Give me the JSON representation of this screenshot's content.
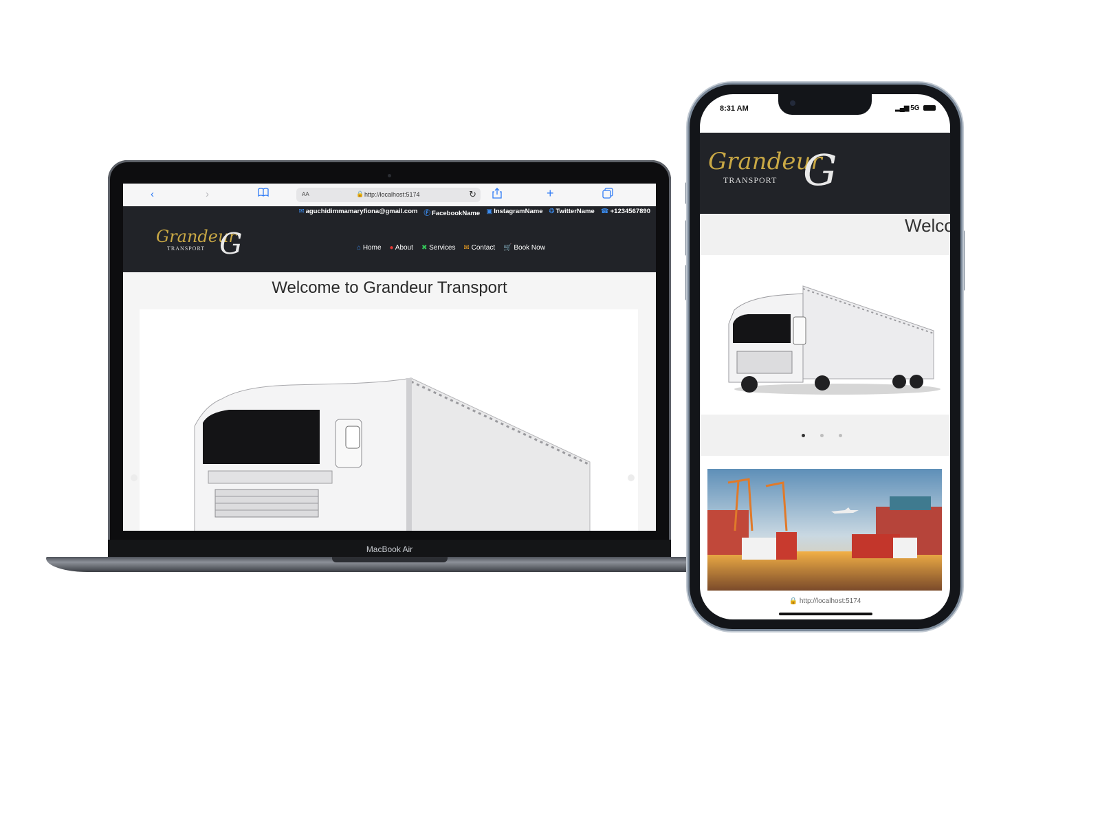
{
  "laptop": {
    "model_label": "MacBook Air",
    "browser": {
      "aa_label": "AA",
      "url": "http://localhost:5174",
      "back_icon": "chevron-left-icon",
      "forward_icon": "chevron-right-icon",
      "bookmarks_icon": "book-icon",
      "reload_icon": "reload-icon",
      "share_icon": "share-icon",
      "new_tab_icon": "plus-icon",
      "tabs_icon": "tabs-icon"
    },
    "site": {
      "contact_strip": {
        "email": "aguchidimmamaryfiona@gmail.com",
        "facebook": "FacebookName",
        "instagram": "InstagramName",
        "twitter": "TwitterName",
        "phone": "+1234567890"
      },
      "logo": {
        "script": "Grandeur",
        "sub": "TRANSPORT",
        "mark": "G"
      },
      "nav": [
        {
          "label": "Home",
          "icon": "home-icon"
        },
        {
          "label": "About",
          "icon": "info-icon"
        },
        {
          "label": "Services",
          "icon": "tools-icon"
        },
        {
          "label": "Contact",
          "icon": "mail-icon"
        },
        {
          "label": "Book Now",
          "icon": "cart-icon"
        }
      ],
      "welcome": "Welcome to Grandeur Transport"
    }
  },
  "phone": {
    "status": {
      "time": "8:31 AM",
      "network": "5G"
    },
    "site": {
      "logo": {
        "script": "Grandeur",
        "sub": "TRANSPORT",
        "mark": "G"
      },
      "welcome_partial": "Welco",
      "carousel_dots": 3
    },
    "url": "http://localhost:5174"
  },
  "colors": {
    "site_header": "#212328",
    "logo_gold": "#c9a845",
    "safari_blue": "#2f7bf5"
  }
}
